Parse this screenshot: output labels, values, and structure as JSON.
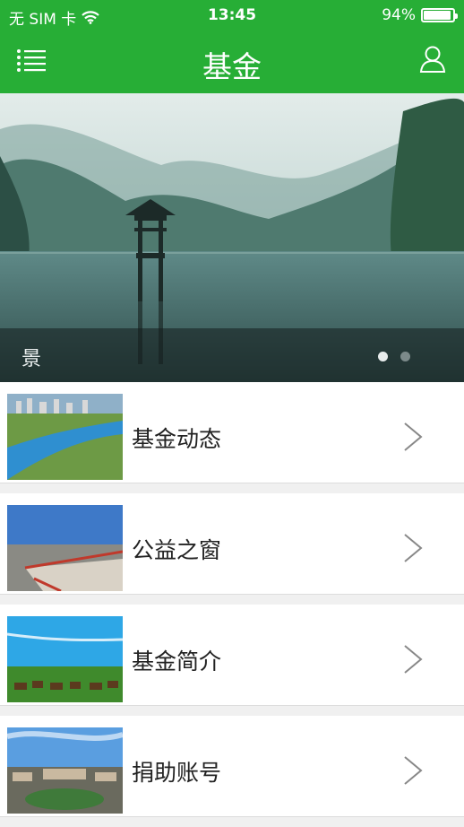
{
  "status_bar": {
    "carrier": "无 SIM 卡",
    "time": "13:45",
    "battery": "94%",
    "battery_level": 0.94
  },
  "header": {
    "title": "基金",
    "menu_icon": "list-icon",
    "user_icon": "user-icon"
  },
  "banner": {
    "caption": "景",
    "page_count": 2,
    "active_page": 1
  },
  "menu": {
    "items": [
      {
        "label": "基金动态"
      },
      {
        "label": "公益之窗"
      },
      {
        "label": "基金简介"
      },
      {
        "label": "捐助账号"
      }
    ]
  },
  "colors": {
    "primary": "#27ae36",
    "background": "#f0f0f0",
    "text": "#222222"
  }
}
